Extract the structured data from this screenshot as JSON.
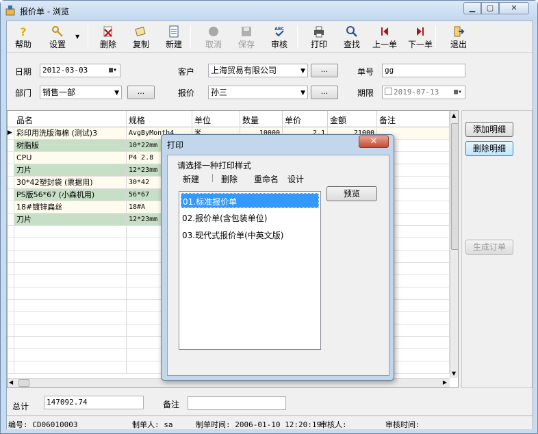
{
  "window": {
    "title": "报价单 - 浏览"
  },
  "toolbar": [
    {
      "label": "帮助",
      "icon": "help-icon",
      "enabled": true
    },
    {
      "label": "设置",
      "icon": "key-icon",
      "enabled": true
    },
    {
      "label": "删除",
      "icon": "delete-icon",
      "enabled": true
    },
    {
      "label": "复制",
      "icon": "copy-icon",
      "enabled": true
    },
    {
      "label": "新建",
      "icon": "new-doc-icon",
      "enabled": true
    },
    {
      "label": "取消",
      "icon": "cancel-icon",
      "enabled": false
    },
    {
      "label": "保存",
      "icon": "save-icon",
      "enabled": false
    },
    {
      "label": "审核",
      "icon": "spellcheck-icon",
      "enabled": true
    },
    {
      "label": "打印",
      "icon": "printer-icon",
      "enabled": true
    },
    {
      "label": "查找",
      "icon": "search-icon",
      "enabled": true
    },
    {
      "label": "上一单",
      "icon": "first-icon",
      "enabled": true
    },
    {
      "label": "下一单",
      "icon": "last-icon",
      "enabled": true
    },
    {
      "label": "退出",
      "icon": "exit-icon",
      "enabled": true
    }
  ],
  "form": {
    "date_label": "日期",
    "date_value": "2012-03-03",
    "customer_label": "客户",
    "customer_value": "上海贸易有限公司",
    "ellipsis": "...",
    "order_no_label": "单号",
    "order_no_value": "gg",
    "dept_label": "部门",
    "dept_value": "销售一部",
    "quoter_label": "报价",
    "quoter_value": "孙三",
    "deadline_label": "期限",
    "deadline_value": "2019-07-13"
  },
  "grid": {
    "columns": [
      "品名",
      "规格",
      "单位",
      "数量",
      "单价",
      "金额",
      "备注"
    ],
    "rows": [
      {
        "name": "彩印用洗版海棉 (测试)3",
        "spec": "AvgByMonth4",
        "unit": "米",
        "qty": "10000",
        "price": "2.1",
        "amount": "21000",
        "note": ""
      },
      {
        "name": "树脂版",
        "spec": "10*22mm",
        "unit": "",
        "qty": "",
        "price": "",
        "amount": "",
        "note": ""
      },
      {
        "name": "CPU",
        "spec": "P4 2.8",
        "unit": "",
        "qty": "",
        "price": "",
        "amount": "",
        "note": ""
      },
      {
        "name": "刀片",
        "spec": "12*23mm",
        "unit": "",
        "qty": "",
        "price": "",
        "amount": "",
        "note": ""
      },
      {
        "name": "30*42塑封袋 (票据用)",
        "spec": "30*42",
        "unit": "",
        "qty": "",
        "price": "",
        "amount": "",
        "note": ""
      },
      {
        "name": "PS版56*67 (小森机用)",
        "spec": "56*67",
        "unit": "",
        "qty": "",
        "price": "",
        "amount": "",
        "note": ""
      },
      {
        "name": "18#镀锌扁丝",
        "spec": "18#A",
        "unit": "",
        "qty": "",
        "price": "",
        "amount": "",
        "note": ""
      },
      {
        "name": "刀片",
        "spec": "12*23mm",
        "unit": "",
        "qty": "",
        "price": "",
        "amount": "",
        "note": ""
      }
    ]
  },
  "side_buttons": {
    "add": "添加明细",
    "delete": "删除明细",
    "generate": "生成订单"
  },
  "footer": {
    "total_label": "总计",
    "total_value": "147092.74",
    "note_label": "备注",
    "note_value": ""
  },
  "status": {
    "number": "编号: CD06010003",
    "creator": "制单人: sa",
    "created_time": "制单时间: 2006-01-10 12:20:19",
    "auditor": "审核人:",
    "audit_time": "审核时间:"
  },
  "dialog": {
    "title": "打印",
    "close": "✕",
    "prompt": "请选择一种打印样式",
    "actions": [
      "新建",
      "删除",
      "重命名",
      "设计"
    ],
    "preview": "预览",
    "styles": [
      "01.标准报价单",
      "02.报价单(含包装单位)",
      "03.现代式报价单(中英文版)"
    ],
    "selected_index": 0
  },
  "colors": {
    "row_odd": "#fffbee",
    "row_even": "#c6dfc6",
    "selection": "#3399ff"
  }
}
